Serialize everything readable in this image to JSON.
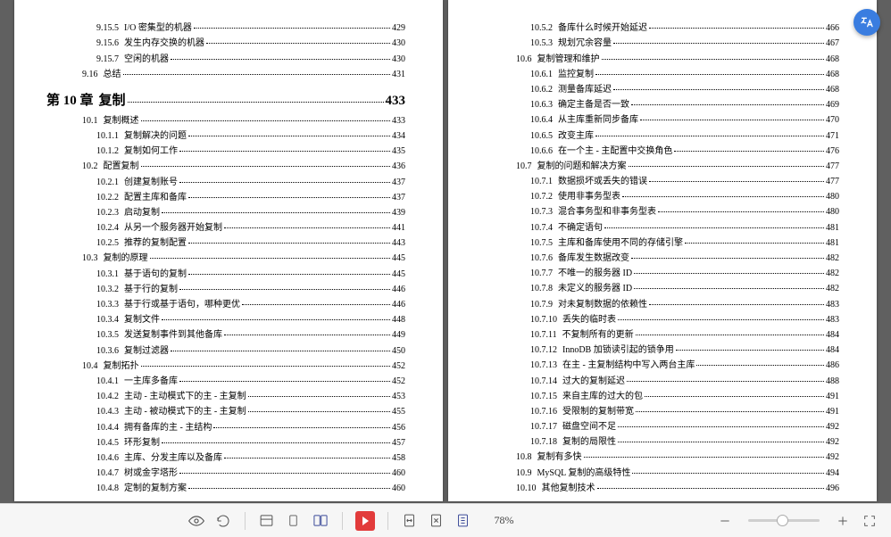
{
  "toolbar": {
    "zoom": "78%"
  },
  "leftPage": [
    {
      "lvl": "lvl3",
      "num": "9.15.5",
      "title": "I/O 密集型的机器",
      "page": "429"
    },
    {
      "lvl": "lvl3",
      "num": "9.15.6",
      "title": "发生内存交换的机器",
      "page": "430"
    },
    {
      "lvl": "lvl3",
      "num": "9.15.7",
      "title": "空闲的机器",
      "page": "430"
    },
    {
      "lvl": "lvl2",
      "num": "9.16",
      "title": "总结",
      "page": "431"
    },
    {
      "lvl": "chapter-row",
      "num": "第 10 章",
      "title": "复制",
      "page": "433"
    },
    {
      "lvl": "lvl2",
      "num": "10.1",
      "title": "复制概述",
      "page": "433"
    },
    {
      "lvl": "lvl3",
      "num": "10.1.1",
      "title": "复制解决的问题",
      "page": "434"
    },
    {
      "lvl": "lvl3",
      "num": "10.1.2",
      "title": "复制如何工作",
      "page": "435"
    },
    {
      "lvl": "lvl2",
      "num": "10.2",
      "title": "配置复制",
      "page": "436"
    },
    {
      "lvl": "lvl3",
      "num": "10.2.1",
      "title": "创建复制账号",
      "page": "437"
    },
    {
      "lvl": "lvl3",
      "num": "10.2.2",
      "title": "配置主库和备库",
      "page": "437"
    },
    {
      "lvl": "lvl3",
      "num": "10.2.3",
      "title": "启动复制",
      "page": "439"
    },
    {
      "lvl": "lvl3",
      "num": "10.2.4",
      "title": "从另一个服务器开始复制",
      "page": "441"
    },
    {
      "lvl": "lvl3",
      "num": "10.2.5",
      "title": "推荐的复制配置",
      "page": "443"
    },
    {
      "lvl": "lvl2",
      "num": "10.3",
      "title": "复制的原理",
      "page": "445"
    },
    {
      "lvl": "lvl3",
      "num": "10.3.1",
      "title": "基于语句的复制",
      "page": "445"
    },
    {
      "lvl": "lvl3",
      "num": "10.3.2",
      "title": "基于行的复制",
      "page": "446"
    },
    {
      "lvl": "lvl3",
      "num": "10.3.3",
      "title": "基于行或基于语句，哪种更优",
      "page": "446"
    },
    {
      "lvl": "lvl3",
      "num": "10.3.4",
      "title": "复制文件",
      "page": "448"
    },
    {
      "lvl": "lvl3",
      "num": "10.3.5",
      "title": "发送复制事件到其他备库",
      "page": "449"
    },
    {
      "lvl": "lvl3",
      "num": "10.3.6",
      "title": "复制过滤器",
      "page": "450"
    },
    {
      "lvl": "lvl2",
      "num": "10.4",
      "title": "复制拓扑",
      "page": "452"
    },
    {
      "lvl": "lvl3",
      "num": "10.4.1",
      "title": "一主库多备库",
      "page": "452"
    },
    {
      "lvl": "lvl3",
      "num": "10.4.2",
      "title": "主动 - 主动模式下的主 - 主复制",
      "page": "453"
    },
    {
      "lvl": "lvl3",
      "num": "10.4.3",
      "title": "主动 - 被动模式下的主 - 主复制",
      "page": "455"
    },
    {
      "lvl": "lvl3",
      "num": "10.4.4",
      "title": "拥有备库的主 - 主结构",
      "page": "456"
    },
    {
      "lvl": "lvl3",
      "num": "10.4.5",
      "title": "环形复制",
      "page": "457"
    },
    {
      "lvl": "lvl3",
      "num": "10.4.6",
      "title": "主库、分发主库以及备库",
      "page": "458"
    },
    {
      "lvl": "lvl3",
      "num": "10.4.7",
      "title": "树或金字塔形",
      "page": "460"
    },
    {
      "lvl": "lvl3",
      "num": "10.4.8",
      "title": "定制的复制方案",
      "page": "460"
    }
  ],
  "rightPage": [
    {
      "lvl": "lvl3",
      "num": "10.5.2",
      "title": "备库什么时候开始延迟",
      "page": "466"
    },
    {
      "lvl": "lvl3",
      "num": "10.5.3",
      "title": "规划冗余容量",
      "page": "467"
    },
    {
      "lvl": "lvl2",
      "num": "10.6",
      "title": "复制管理和维护",
      "page": "468"
    },
    {
      "lvl": "lvl3",
      "num": "10.6.1",
      "title": "监控复制",
      "page": "468"
    },
    {
      "lvl": "lvl3",
      "num": "10.6.2",
      "title": "测量备库延迟",
      "page": "468"
    },
    {
      "lvl": "lvl3",
      "num": "10.6.3",
      "title": "确定主备是否一致",
      "page": "469"
    },
    {
      "lvl": "lvl3",
      "num": "10.6.4",
      "title": "从主库重新同步备库",
      "page": "470"
    },
    {
      "lvl": "lvl3",
      "num": "10.6.5",
      "title": "改变主库",
      "page": "471"
    },
    {
      "lvl": "lvl3",
      "num": "10.6.6",
      "title": "在一个主 - 主配置中交换角色",
      "page": "476"
    },
    {
      "lvl": "lvl2",
      "num": "10.7",
      "title": "复制的问题和解决方案",
      "page": "477"
    },
    {
      "lvl": "lvl3",
      "num": "10.7.1",
      "title": "数据损坏或丢失的错误",
      "page": "477"
    },
    {
      "lvl": "lvl3",
      "num": "10.7.2",
      "title": "使用非事务型表",
      "page": "480"
    },
    {
      "lvl": "lvl3",
      "num": "10.7.3",
      "title": "混合事务型和非事务型表",
      "page": "480"
    },
    {
      "lvl": "lvl3",
      "num": "10.7.4",
      "title": "不确定语句",
      "page": "481"
    },
    {
      "lvl": "lvl3",
      "num": "10.7.5",
      "title": "主库和备库使用不同的存储引擎",
      "page": "481"
    },
    {
      "lvl": "lvl3",
      "num": "10.7.6",
      "title": "备库发生数据改变",
      "page": "482"
    },
    {
      "lvl": "lvl3",
      "num": "10.7.7",
      "title": "不唯一的服务器 ID",
      "page": "482"
    },
    {
      "lvl": "lvl3",
      "num": "10.7.8",
      "title": "未定义的服务器 ID",
      "page": "482"
    },
    {
      "lvl": "lvl3",
      "num": "10.7.9",
      "title": "对未复制数据的依赖性",
      "page": "483"
    },
    {
      "lvl": "lvl3",
      "num": "10.7.10",
      "title": "丢失的临时表",
      "page": "483"
    },
    {
      "lvl": "lvl3",
      "num": "10.7.11",
      "title": "不复制所有的更新",
      "page": "484"
    },
    {
      "lvl": "lvl3",
      "num": "10.7.12",
      "title": "InnoDB 加锁读引起的锁争用",
      "page": "484"
    },
    {
      "lvl": "lvl3",
      "num": "10.7.13",
      "title": "在主 - 主复制结构中写入两台主库",
      "page": "486"
    },
    {
      "lvl": "lvl3",
      "num": "10.7.14",
      "title": "过大的复制延迟",
      "page": "488"
    },
    {
      "lvl": "lvl3",
      "num": "10.7.15",
      "title": "来自主库的过大的包",
      "page": "491"
    },
    {
      "lvl": "lvl3",
      "num": "10.7.16",
      "title": "受限制的复制带宽",
      "page": "491"
    },
    {
      "lvl": "lvl3",
      "num": "10.7.17",
      "title": "磁盘空间不足",
      "page": "492"
    },
    {
      "lvl": "lvl3",
      "num": "10.7.18",
      "title": "复制的局限性",
      "page": "492"
    },
    {
      "lvl": "lvl2",
      "num": "10.8",
      "title": "复制有多快",
      "page": "492"
    },
    {
      "lvl": "lvl2",
      "num": "10.9",
      "title": "MySQL 复制的高级特性",
      "page": "494"
    },
    {
      "lvl": "lvl2",
      "num": "10.10",
      "title": "其他复制技术",
      "page": "496"
    }
  ]
}
